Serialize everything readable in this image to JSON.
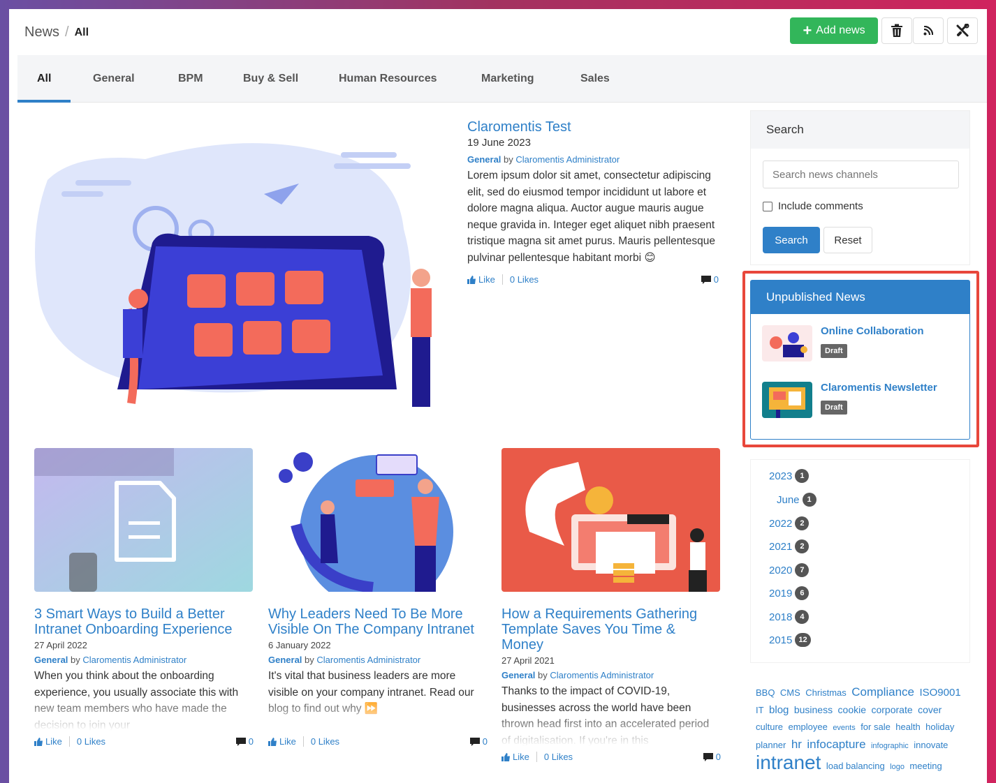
{
  "header": {
    "breadcrumb_root": "News",
    "breadcrumb_sep": "/",
    "breadcrumb_current": "All",
    "add_label": "Add news",
    "accent": "#32b65a"
  },
  "icons": [
    "plus-icon",
    "trash-icon",
    "rss-icon",
    "tools-icon",
    "thumbs-up-icon",
    "comment-icon"
  ],
  "tabs": [
    {
      "label": "All",
      "active": true
    },
    {
      "label": "General"
    },
    {
      "label": "BPM"
    },
    {
      "label": "Buy & Sell"
    },
    {
      "label": "Human Resources"
    },
    {
      "label": "Marketing"
    },
    {
      "label": "Sales"
    }
  ],
  "featured": {
    "title": "Claromentis Test",
    "date": "19 June 2023",
    "category": "General",
    "by": "by",
    "author": "Claromentis Administrator",
    "body": "Lorem ipsum dolor sit amet, consectetur adipiscing elit, sed do eiusmod tempor incididunt ut labore et dolore magna aliqua. Auctor augue mauris augue neque gravida in. Integer eget aliquet nibh praesent tristique magna sit amet purus. Mauris pellentesque pulvinar pellentesque habitant morbi 😊",
    "like": "Like",
    "likes": "0 Likes",
    "comments": "0"
  },
  "cards": [
    {
      "title": "3 Smart Ways to Build a Better Intranet Onboarding Experience",
      "date": "27 April 2022",
      "category": "General",
      "by": "by",
      "author": "Claromentis Administrator",
      "body": "When you think about the onboarding experience, you usually associate this with new team members who have made the decision to join your",
      "like": "Like",
      "likes": "0 Likes",
      "comments": "0"
    },
    {
      "title": "Why Leaders Need To Be More Visible On The Company Intranet",
      "date": "6 January 2022",
      "category": "General",
      "by": "by",
      "author": "Claromentis Administrator",
      "body": "It's vital that business leaders are more visible on your company intranet. Read our blog to find out why ⏩",
      "like": "Like",
      "likes": "0 Likes",
      "comments": "0"
    },
    {
      "title": "How a Requirements Gathering Template Saves You Time & Money",
      "date": "27 April 2021",
      "category": "General",
      "by": "by",
      "author": "Claromentis Administrator",
      "body": "Thanks to the impact of COVID-19, businesses across the world have been thrown head first into an accelerated period of digitalisation. If you're in this",
      "like": "Like",
      "likes": "0 Likes",
      "comments": "0"
    }
  ],
  "search": {
    "heading": "Search",
    "placeholder": "Search news channels",
    "include_comments": "Include comments",
    "search_button": "Search",
    "reset_button": "Reset"
  },
  "unpublished": {
    "heading": "Unpublished News",
    "items": [
      {
        "name": "Online Collaboration",
        "status": "Draft"
      },
      {
        "name": "Claromentis Newsletter",
        "status": "Draft"
      }
    ]
  },
  "archive": [
    {
      "label": "2023",
      "count": "1"
    },
    {
      "label": "June",
      "count": "1",
      "indent": true
    },
    {
      "label": "2022",
      "count": "2"
    },
    {
      "label": "2021",
      "count": "2"
    },
    {
      "label": "2020",
      "count": "7"
    },
    {
      "label": "2019",
      "count": "6"
    },
    {
      "label": "2018",
      "count": "4"
    },
    {
      "label": "2015",
      "count": "12"
    }
  ],
  "tags": [
    {
      "t": "BBQ",
      "s": 13
    },
    {
      "t": "CMS",
      "s": 13
    },
    {
      "t": "Christmas",
      "s": 13
    },
    {
      "t": "Compliance",
      "s": 17
    },
    {
      "t": "ISO9001",
      "s": 15
    },
    {
      "t": "IT",
      "s": 13
    },
    {
      "t": "blog",
      "s": 15
    },
    {
      "t": "business",
      "s": 14
    },
    {
      "t": "cookie",
      "s": 14
    },
    {
      "t": "corporate",
      "s": 14
    },
    {
      "t": "cover",
      "s": 14
    },
    {
      "t": "culture",
      "s": 13
    },
    {
      "t": "employee",
      "s": 13
    },
    {
      "t": "events",
      "s": 11
    },
    {
      "t": "for sale",
      "s": 13
    },
    {
      "t": "health",
      "s": 13
    },
    {
      "t": "holiday",
      "s": 13
    },
    {
      "t": "planner",
      "s": 13
    },
    {
      "t": "hr",
      "s": 17
    },
    {
      "t": "infocapture",
      "s": 17
    },
    {
      "t": "infographic",
      "s": 11
    },
    {
      "t": "innovate",
      "s": 13
    },
    {
      "t": "intranet",
      "s": 28
    },
    {
      "t": "load balancing",
      "s": 13
    },
    {
      "t": "logo",
      "s": 11
    },
    {
      "t": "meeting",
      "s": 13
    }
  ]
}
